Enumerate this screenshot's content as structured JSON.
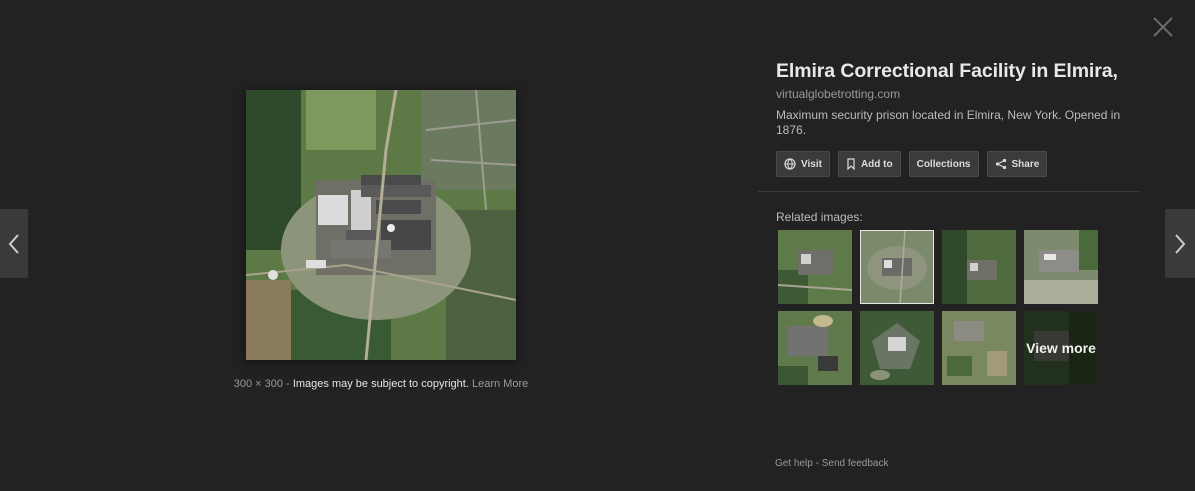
{
  "viewer": {
    "close_icon": "close-icon",
    "prev_icon": "chevron-left-icon",
    "next_icon": "chevron-right-icon"
  },
  "image": {
    "dimensions": "300 × 300",
    "separator": "-",
    "copyright": "Images may be subject to copyright.",
    "learn_more": "Learn More"
  },
  "panel": {
    "title": "Elmira Correctional Facility in Elmira, …",
    "domain": "virtualglobetrotting.com",
    "description": "Maximum security prison located in Elmira, New York. Opened in 1876.",
    "buttons": [
      {
        "label": "Visit",
        "icon": "globe-icon"
      },
      {
        "label": "Add to",
        "icon": "bookmark-icon"
      },
      {
        "label": "Collections",
        "icon": ""
      },
      {
        "label": "Share",
        "icon": "share-icon"
      }
    ]
  },
  "related": {
    "label": "Related images:",
    "view_more": "View more"
  },
  "footer": {
    "get_help": "Get help",
    "separator": "-",
    "send_feedback": "Send feedback"
  },
  "colors": {
    "background": "#222222",
    "button_bg": "#3b3b3b"
  }
}
